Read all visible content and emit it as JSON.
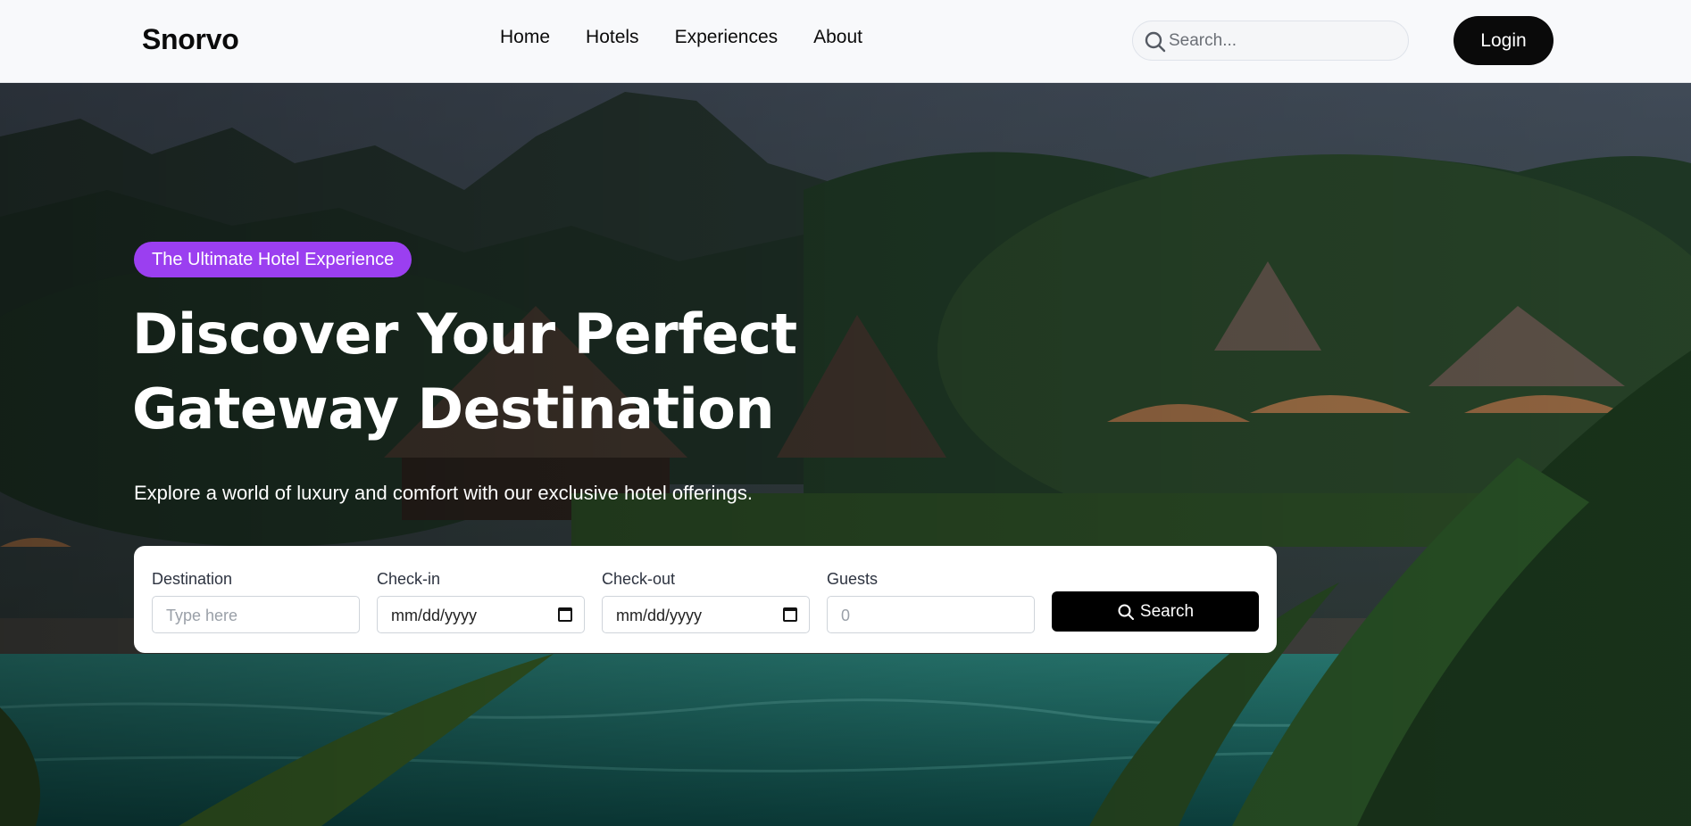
{
  "header": {
    "logo": "Snorvo",
    "nav": [
      "Home",
      "Hotels",
      "Experiences",
      "About"
    ],
    "search_placeholder": "Search...",
    "login_label": "Login"
  },
  "hero": {
    "badge": "The Ultimate Hotel Experience",
    "headline_line1": "Discover Your Perfect",
    "headline_line2": "Gateway Destination",
    "subtitle": "Explore a world of luxury and comfort with our exclusive hotel offerings."
  },
  "booking": {
    "destination": {
      "label": "Destination",
      "placeholder": "Type here"
    },
    "checkin": {
      "label": "Check-in",
      "value": "mm/dd/yyyy"
    },
    "checkout": {
      "label": "Check-out",
      "value": "mm/dd/yyyy"
    },
    "guests": {
      "label": "Guests",
      "placeholder": "0"
    },
    "search_label": "Search"
  },
  "colors": {
    "badge": "#9b3ff0",
    "primary_button": "#0a0a0a",
    "header_bg": "#f8f9fb"
  }
}
